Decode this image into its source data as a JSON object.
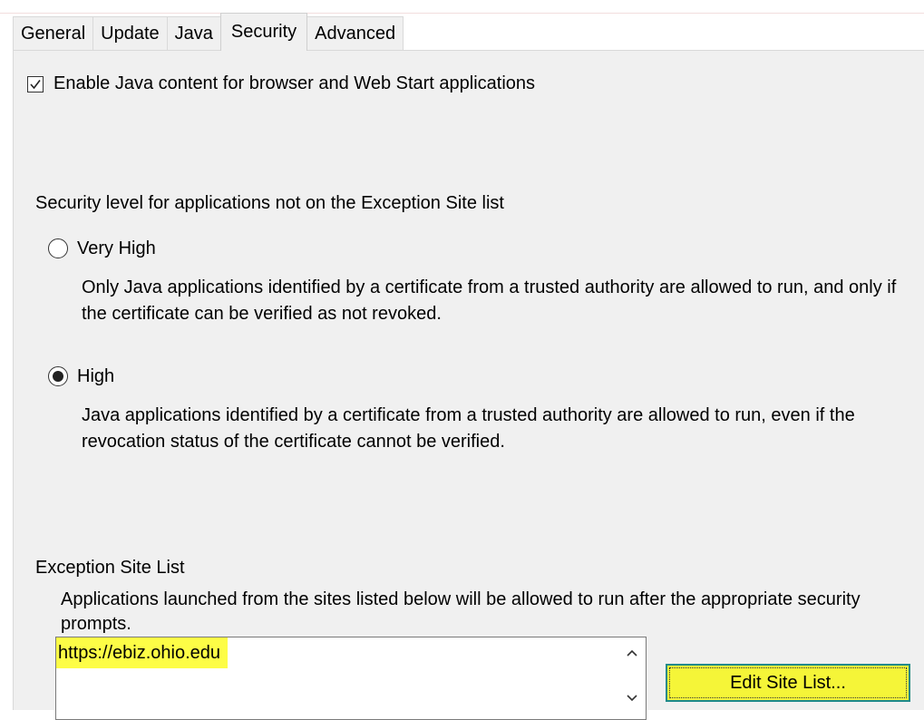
{
  "tabs": [
    {
      "label": "General",
      "active": false
    },
    {
      "label": "Update",
      "active": false
    },
    {
      "label": "Java",
      "active": false
    },
    {
      "label": "Security",
      "active": true
    },
    {
      "label": "Advanced",
      "active": false
    }
  ],
  "enable_java": {
    "label": "Enable Java content for browser and Web Start applications",
    "checked": true
  },
  "security_level": {
    "heading": "Security level for applications not on the Exception Site list",
    "options": [
      {
        "label": "Very High",
        "selected": false,
        "description": "Only Java applications identified by a certificate from a trusted authority are allowed to run, and only if the certificate can be verified as not revoked."
      },
      {
        "label": "High",
        "selected": true,
        "description": "Java applications identified by a certificate from a trusted authority are allowed to run, even if the revocation status of the certificate cannot be verified."
      }
    ]
  },
  "exception_site_list": {
    "heading": "Exception Site List",
    "description": "Applications launched from the sites listed below will be allowed to run after the appropriate security prompts.",
    "sites": [
      "https://ebiz.ohio.edu"
    ],
    "edit_button": "Edit Site List..."
  },
  "colors": {
    "highlight": "#fdfd46",
    "button_highlight": "#f5f538",
    "panel_bg": "#f0f0f0"
  },
  "icons": {
    "checkbox": "check-icon",
    "scroll_up": "chevron-up-icon",
    "scroll_down": "chevron-down-icon"
  }
}
